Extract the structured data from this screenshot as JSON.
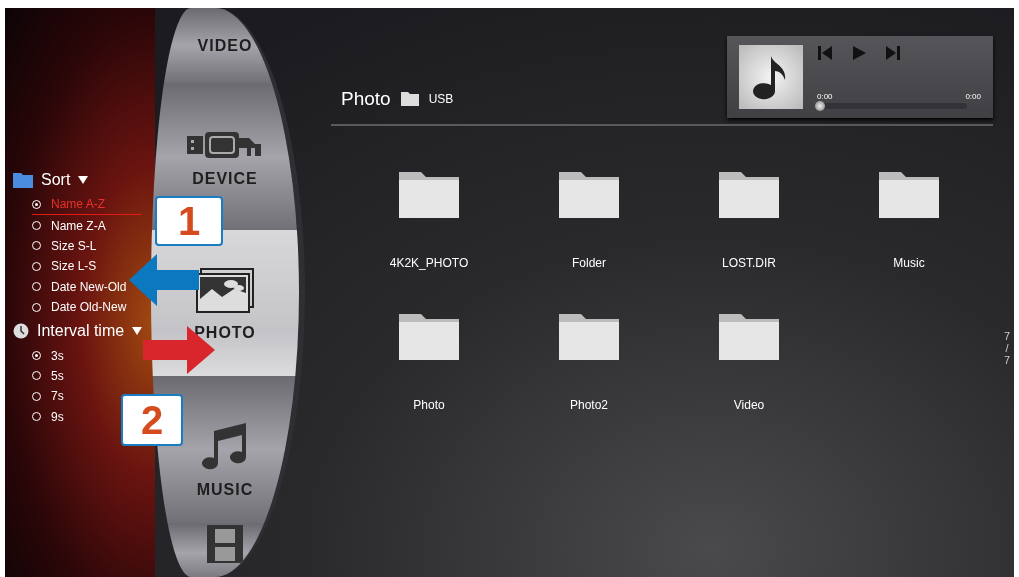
{
  "sort": {
    "label": "Sort",
    "options": [
      {
        "label": "Name A-Z",
        "selected": true
      },
      {
        "label": "Name Z-A",
        "selected": false
      },
      {
        "label": "Size S-L",
        "selected": false
      },
      {
        "label": "Size L-S",
        "selected": false
      },
      {
        "label": "Date New-Old",
        "selected": false
      },
      {
        "label": "Date Old-New",
        "selected": false
      }
    ]
  },
  "interval": {
    "label": "Interval time",
    "options": [
      {
        "label": "3s",
        "selected": true
      },
      {
        "label": "5s",
        "selected": false
      },
      {
        "label": "7s",
        "selected": false
      },
      {
        "label": "9s",
        "selected": false
      }
    ]
  },
  "wheel": [
    {
      "kind": "video",
      "label": "VIDEO",
      "selected": false
    },
    {
      "kind": "device",
      "label": "DEVICE",
      "selected": false
    },
    {
      "kind": "photo",
      "label": "PHOTO",
      "selected": true
    },
    {
      "kind": "music",
      "label": "MUSIC",
      "selected": false
    },
    {
      "kind": "film",
      "selected": false
    }
  ],
  "header": {
    "title": "Photo",
    "source": "USB"
  },
  "player": {
    "elapsed": "0:00",
    "duration": "0:00",
    "level": 0
  },
  "folders": [
    "4K2K_PHOTO",
    "Folder",
    "LOST.DIR",
    "Music",
    "Photo",
    "Photo2",
    "Video"
  ],
  "page_indicator": "7/7",
  "annotations": [
    {
      "number": "1",
      "kind": "left",
      "color": "#0b78c0"
    },
    {
      "number": "2",
      "kind": "right",
      "color": "#d8262c"
    }
  ]
}
